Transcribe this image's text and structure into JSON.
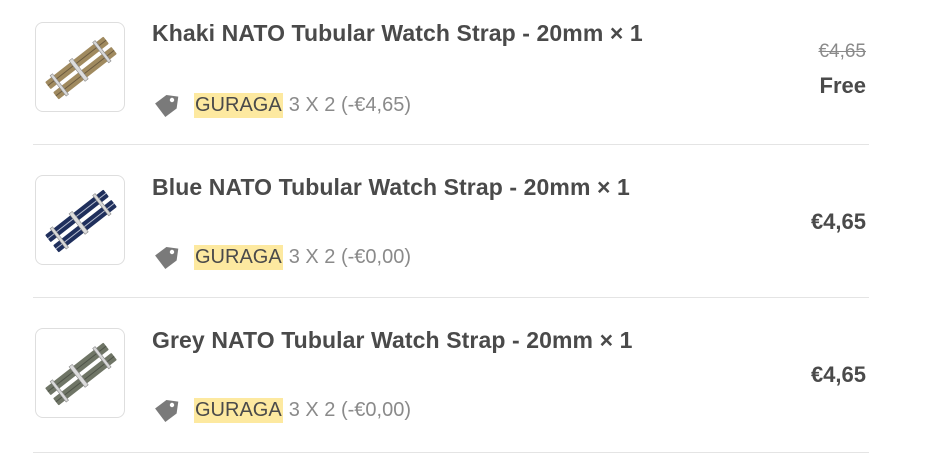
{
  "items": [
    {
      "title": "Khaki NATO Tubular Watch Strap - 20mm × 1",
      "discount_code": "GURAGA",
      "discount_text": "3 X 2 (-€4,65)",
      "original_price": "€4,65",
      "price": "Free",
      "strap_color": "#a08a5f",
      "stripe_color": "#6b5a3e"
    },
    {
      "title": "Blue NATO Tubular Watch Strap - 20mm × 1",
      "discount_code": "GURAGA",
      "discount_text": "3 X 2 (-€0,00)",
      "original_price": "",
      "price": "€4,65",
      "strap_color": "#1f2f5c",
      "stripe_color": "#b9c0d2"
    },
    {
      "title": "Grey NATO Tubular Watch Strap - 20mm × 1",
      "discount_code": "GURAGA",
      "discount_text": "3 X 2 (-€0,00)",
      "original_price": "",
      "price": "€4,65",
      "strap_color": "#6f7566",
      "stripe_color": "#4e5348"
    }
  ],
  "colors": {
    "code_highlight": "#fde9a0",
    "tag_icon": "#7a7a7a",
    "divider": "#e4e4e4"
  },
  "icons": {
    "discount": "price-tag-icon"
  }
}
